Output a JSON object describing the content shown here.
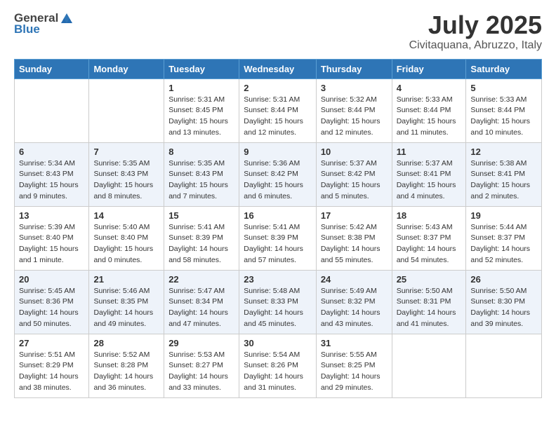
{
  "header": {
    "logo_general": "General",
    "logo_blue": "Blue",
    "month": "July 2025",
    "location": "Civitaquana, Abruzzo, Italy"
  },
  "weekdays": [
    "Sunday",
    "Monday",
    "Tuesday",
    "Wednesday",
    "Thursday",
    "Friday",
    "Saturday"
  ],
  "weeks": [
    [
      {
        "day": "",
        "info": ""
      },
      {
        "day": "",
        "info": ""
      },
      {
        "day": "1",
        "sunrise": "Sunrise: 5:31 AM",
        "sunset": "Sunset: 8:45 PM",
        "daylight": "Daylight: 15 hours and 13 minutes."
      },
      {
        "day": "2",
        "sunrise": "Sunrise: 5:31 AM",
        "sunset": "Sunset: 8:44 PM",
        "daylight": "Daylight: 15 hours and 12 minutes."
      },
      {
        "day": "3",
        "sunrise": "Sunrise: 5:32 AM",
        "sunset": "Sunset: 8:44 PM",
        "daylight": "Daylight: 15 hours and 12 minutes."
      },
      {
        "day": "4",
        "sunrise": "Sunrise: 5:33 AM",
        "sunset": "Sunset: 8:44 PM",
        "daylight": "Daylight: 15 hours and 11 minutes."
      },
      {
        "day": "5",
        "sunrise": "Sunrise: 5:33 AM",
        "sunset": "Sunset: 8:44 PM",
        "daylight": "Daylight: 15 hours and 10 minutes."
      }
    ],
    [
      {
        "day": "6",
        "sunrise": "Sunrise: 5:34 AM",
        "sunset": "Sunset: 8:43 PM",
        "daylight": "Daylight: 15 hours and 9 minutes."
      },
      {
        "day": "7",
        "sunrise": "Sunrise: 5:35 AM",
        "sunset": "Sunset: 8:43 PM",
        "daylight": "Daylight: 15 hours and 8 minutes."
      },
      {
        "day": "8",
        "sunrise": "Sunrise: 5:35 AM",
        "sunset": "Sunset: 8:43 PM",
        "daylight": "Daylight: 15 hours and 7 minutes."
      },
      {
        "day": "9",
        "sunrise": "Sunrise: 5:36 AM",
        "sunset": "Sunset: 8:42 PM",
        "daylight": "Daylight: 15 hours and 6 minutes."
      },
      {
        "day": "10",
        "sunrise": "Sunrise: 5:37 AM",
        "sunset": "Sunset: 8:42 PM",
        "daylight": "Daylight: 15 hours and 5 minutes."
      },
      {
        "day": "11",
        "sunrise": "Sunrise: 5:37 AM",
        "sunset": "Sunset: 8:41 PM",
        "daylight": "Daylight: 15 hours and 4 minutes."
      },
      {
        "day": "12",
        "sunrise": "Sunrise: 5:38 AM",
        "sunset": "Sunset: 8:41 PM",
        "daylight": "Daylight: 15 hours and 2 minutes."
      }
    ],
    [
      {
        "day": "13",
        "sunrise": "Sunrise: 5:39 AM",
        "sunset": "Sunset: 8:40 PM",
        "daylight": "Daylight: 15 hours and 1 minute."
      },
      {
        "day": "14",
        "sunrise": "Sunrise: 5:40 AM",
        "sunset": "Sunset: 8:40 PM",
        "daylight": "Daylight: 15 hours and 0 minutes."
      },
      {
        "day": "15",
        "sunrise": "Sunrise: 5:41 AM",
        "sunset": "Sunset: 8:39 PM",
        "daylight": "Daylight: 14 hours and 58 minutes."
      },
      {
        "day": "16",
        "sunrise": "Sunrise: 5:41 AM",
        "sunset": "Sunset: 8:39 PM",
        "daylight": "Daylight: 14 hours and 57 minutes."
      },
      {
        "day": "17",
        "sunrise": "Sunrise: 5:42 AM",
        "sunset": "Sunset: 8:38 PM",
        "daylight": "Daylight: 14 hours and 55 minutes."
      },
      {
        "day": "18",
        "sunrise": "Sunrise: 5:43 AM",
        "sunset": "Sunset: 8:37 PM",
        "daylight": "Daylight: 14 hours and 54 minutes."
      },
      {
        "day": "19",
        "sunrise": "Sunrise: 5:44 AM",
        "sunset": "Sunset: 8:37 PM",
        "daylight": "Daylight: 14 hours and 52 minutes."
      }
    ],
    [
      {
        "day": "20",
        "sunrise": "Sunrise: 5:45 AM",
        "sunset": "Sunset: 8:36 PM",
        "daylight": "Daylight: 14 hours and 50 minutes."
      },
      {
        "day": "21",
        "sunrise": "Sunrise: 5:46 AM",
        "sunset": "Sunset: 8:35 PM",
        "daylight": "Daylight: 14 hours and 49 minutes."
      },
      {
        "day": "22",
        "sunrise": "Sunrise: 5:47 AM",
        "sunset": "Sunset: 8:34 PM",
        "daylight": "Daylight: 14 hours and 47 minutes."
      },
      {
        "day": "23",
        "sunrise": "Sunrise: 5:48 AM",
        "sunset": "Sunset: 8:33 PM",
        "daylight": "Daylight: 14 hours and 45 minutes."
      },
      {
        "day": "24",
        "sunrise": "Sunrise: 5:49 AM",
        "sunset": "Sunset: 8:32 PM",
        "daylight": "Daylight: 14 hours and 43 minutes."
      },
      {
        "day": "25",
        "sunrise": "Sunrise: 5:50 AM",
        "sunset": "Sunset: 8:31 PM",
        "daylight": "Daylight: 14 hours and 41 minutes."
      },
      {
        "day": "26",
        "sunrise": "Sunrise: 5:50 AM",
        "sunset": "Sunset: 8:30 PM",
        "daylight": "Daylight: 14 hours and 39 minutes."
      }
    ],
    [
      {
        "day": "27",
        "sunrise": "Sunrise: 5:51 AM",
        "sunset": "Sunset: 8:29 PM",
        "daylight": "Daylight: 14 hours and 38 minutes."
      },
      {
        "day": "28",
        "sunrise": "Sunrise: 5:52 AM",
        "sunset": "Sunset: 8:28 PM",
        "daylight": "Daylight: 14 hours and 36 minutes."
      },
      {
        "day": "29",
        "sunrise": "Sunrise: 5:53 AM",
        "sunset": "Sunset: 8:27 PM",
        "daylight": "Daylight: 14 hours and 33 minutes."
      },
      {
        "day": "30",
        "sunrise": "Sunrise: 5:54 AM",
        "sunset": "Sunset: 8:26 PM",
        "daylight": "Daylight: 14 hours and 31 minutes."
      },
      {
        "day": "31",
        "sunrise": "Sunrise: 5:55 AM",
        "sunset": "Sunset: 8:25 PM",
        "daylight": "Daylight: 14 hours and 29 minutes."
      },
      {
        "day": "",
        "info": ""
      },
      {
        "day": "",
        "info": ""
      }
    ]
  ]
}
